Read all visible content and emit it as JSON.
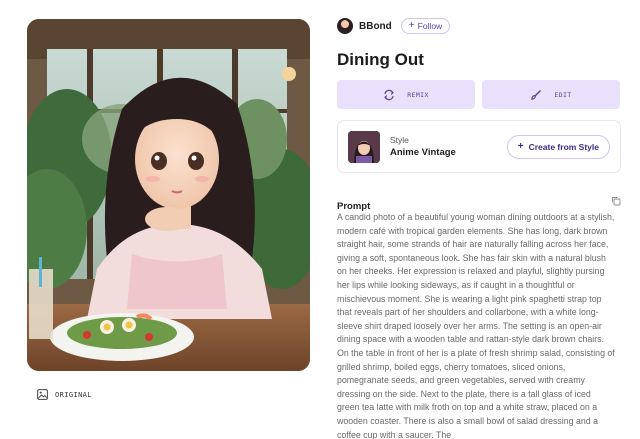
{
  "author": {
    "name": "BBond",
    "follow_label": "Follow",
    "follow_icon": "+"
  },
  "title": "Dining Out",
  "actions": {
    "remix_label": "REMIX",
    "edit_label": "EDIT"
  },
  "style": {
    "kicker": "Style",
    "name": "Anime Vintage",
    "create_label": "Create from Style",
    "create_icon": "+"
  },
  "prompt": {
    "label": "Prompt",
    "text": "A candid photo of a beautiful young woman dining outdoors at a stylish, modern café with tropical garden elements. She has long, dark brown straight hair, some strands of hair are naturally falling across her face, giving a soft, spontaneous look. She has fair skin with a natural blush on her cheeks. Her expression is relaxed and playful, slightly pursing her lips while looking sideways, as if caught in a thoughtful or mischievous moment. She is wearing a light pink spaghetti strap top that reveals part of her shoulders and collarbone, with a white long-sleeve shirt draped loosely over her arms. The setting is an open-air dining space with a wooden table and rattan-style dark brown chairs. On the table in front of her is a plate of fresh shrimp salad, consisting of grilled shrimp, boiled eggs, cherry tomatoes, sliced onions, pomegranate seeds, and green vegetables, served with creamy dressing on the side. Next to the plate, there is a tall glass of iced green tea latte with milk froth on top and a white straw, placed on a wooden coaster. There is also a small bowl of salad dressing and a coffee cup with a saucer. The"
  },
  "image": {
    "original_label": "ORIGINAL"
  },
  "colors": {
    "accent": "#5b3fb5",
    "button_bg": "#e9e0fb"
  }
}
